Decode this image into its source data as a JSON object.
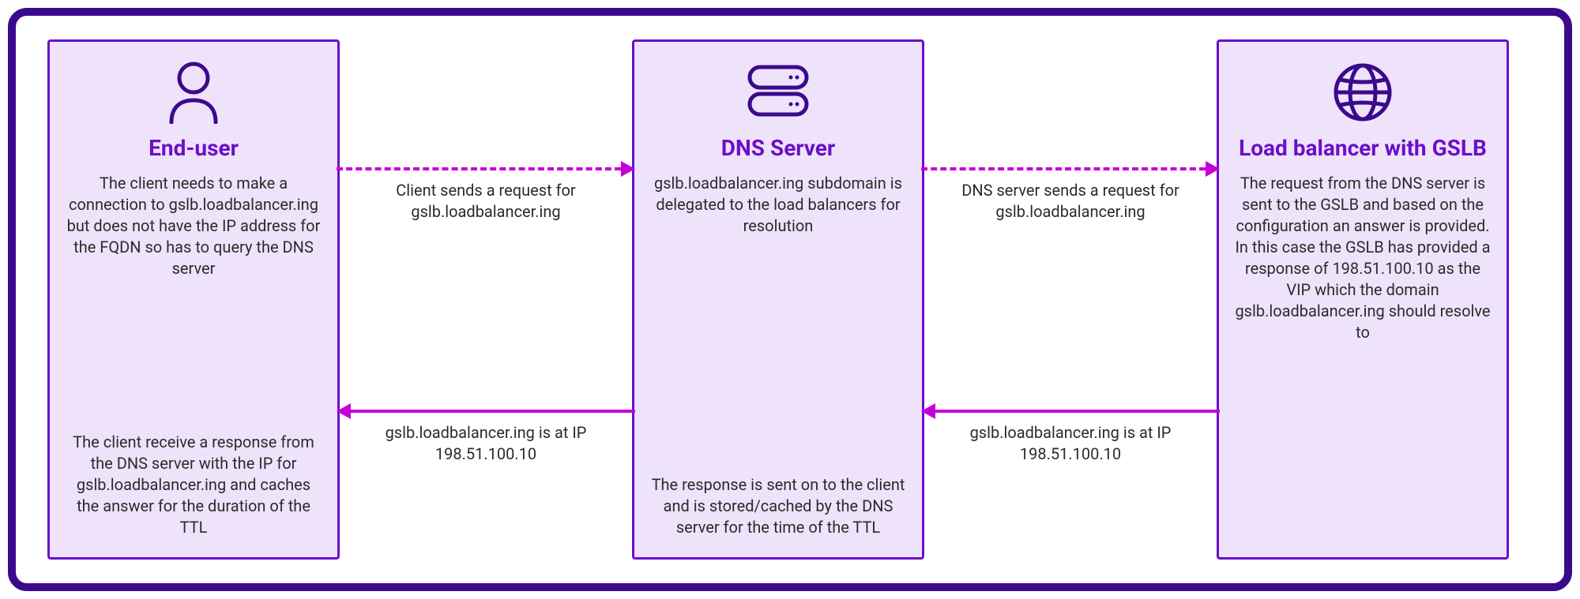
{
  "nodes": {
    "end_user": {
      "title": "End-user",
      "desc1": "The client needs to make a connection to gslb.loadbalancer.ing but does not have the IP address for the FQDN so has to query the DNS server",
      "desc2": "The client receive a response from the DNS server with the IP for gslb.loadbalancer.ing and caches the answer for the duration of the TTL"
    },
    "dns_server": {
      "title": "DNS Server",
      "desc1": "gslb.loadbalancer.ing subdomain is delegated to the load balancers for resolution",
      "desc2": "The response is sent on to the client and is stored/cached by the DNS server for the time of the TTL"
    },
    "load_balancer": {
      "title": "Load balancer with GSLB",
      "desc1": "The request from the DNS server is sent to the GSLB and based on the configuration an answer is provided. In this case the GSLB has provided a response of 198.51.100.10 as the VIP which the domain gslb.loadbalancer.ing should resolve to"
    }
  },
  "arrows": {
    "a1": {
      "label": "Client sends a request for gslb.loadbalancer.ing"
    },
    "a2": {
      "label": "DNS server sends a request for gslb.loadbalancer.ing"
    },
    "a3": {
      "label": "gslb.loadbalancer.ing is at IP 198.51.100.10"
    },
    "a4": {
      "label": "gslb.loadbalancer.ing is at IP 198.51.100.10"
    }
  },
  "colors": {
    "frame": "#3b0a8c",
    "node_border": "#6b0fc9",
    "node_fill": "#efe3fb",
    "arrow": "#c400d6"
  }
}
